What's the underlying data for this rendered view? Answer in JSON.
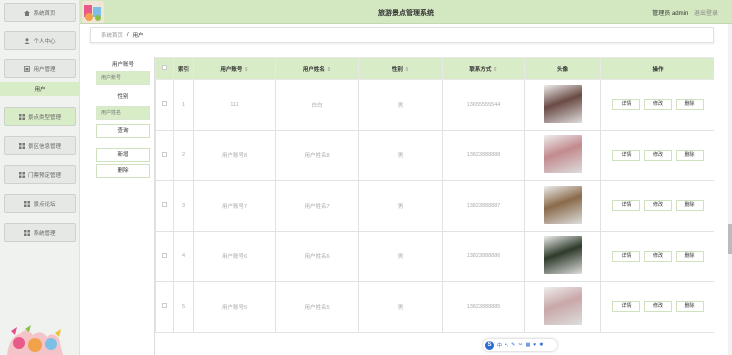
{
  "header": {
    "title": "旅游景点管理系统",
    "user_label": "管理员 admin",
    "logout": "退出登录"
  },
  "breadcrumb": {
    "home": "系统首页",
    "sep": "/",
    "current": "用户"
  },
  "sidebar": {
    "items": [
      {
        "label": "系统首页",
        "icon": "home-icon"
      },
      {
        "label": "个人中心",
        "icon": "person-icon"
      },
      {
        "label": "用户管理",
        "icon": "user-manage-icon"
      },
      {
        "label": "景点类型管理",
        "icon": "grid-icon"
      },
      {
        "label": "景区信息管理",
        "icon": "grid-icon"
      },
      {
        "label": "门票预定管理",
        "icon": "grid-icon"
      },
      {
        "label": "景点论坛",
        "icon": "grid-icon"
      },
      {
        "label": "系统管理",
        "icon": "grid-icon"
      }
    ],
    "active_sub": "用户"
  },
  "search": {
    "label_account": "用户账号",
    "placeholder_account": "用户账号",
    "gender_label": "性别",
    "placeholder_name": "用户姓名",
    "query": "查询",
    "add": "新增",
    "delete": "删除"
  },
  "table": {
    "columns": [
      "索引",
      "用户账号",
      "用户姓名",
      "性别",
      "联系方式",
      "头像",
      "操作"
    ],
    "rows": [
      {
        "index": "1",
        "account": "111",
        "name": "白白",
        "gender": "男",
        "phone": "13655555544",
        "avatar_color": "#6a4a44"
      },
      {
        "index": "2",
        "account": "用户账号8",
        "name": "用户姓名8",
        "gender": "男",
        "phone": "13823888888",
        "avatar_color": "#c28a8e"
      },
      {
        "index": "3",
        "account": "用户账号7",
        "name": "用户姓名7",
        "gender": "男",
        "phone": "13823888887",
        "avatar_color": "#8a6a4a"
      },
      {
        "index": "4",
        "account": "用户账号6",
        "name": "用户姓名6",
        "gender": "男",
        "phone": "13823888886",
        "avatar_color": "#2e3a2a"
      },
      {
        "index": "5",
        "account": "用户账号5",
        "name": "用户姓名5",
        "gender": "男",
        "phone": "13823888885",
        "avatar_color": "#c9a7a8"
      }
    ],
    "actions": {
      "detail": "详情",
      "edit": "修改",
      "delete": "删除"
    }
  },
  "float_toolbar": {
    "label": "中"
  },
  "colors": {
    "accent": "#d9ecc8",
    "header": "#d3e8c0"
  }
}
